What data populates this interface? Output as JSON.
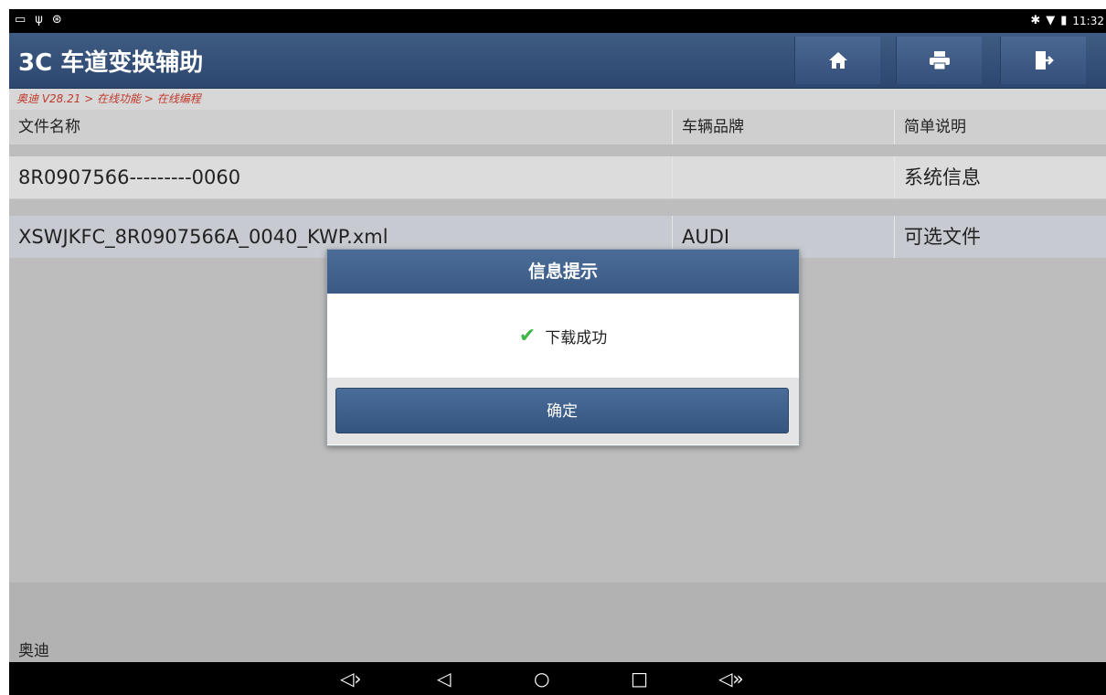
{
  "app": {
    "title": "3C 车道变换辅助",
    "breadcrumb": "奥迪 V28.21 > 在线功能 > 在线编程"
  },
  "status_bar": {
    "left_icons": [
      "image-icon",
      "usb-icon",
      "settings-icon"
    ],
    "right_icons": [
      "bluetooth-icon",
      "wifi-icon",
      "battery-icon"
    ],
    "time": "11:32"
  },
  "toolbar": {
    "home_icon": "home-icon",
    "print_icon": "print-icon",
    "exit_icon": "exit-icon"
  },
  "table": {
    "headers": [
      "文件名称",
      "车辆品牌",
      "简单说明"
    ],
    "rows": [
      [
        "8R0907566---------0060",
        "",
        "系统信息"
      ],
      [
        "XSWJKFC_8R0907566A_0040_KWP.xml",
        "AUDI",
        "可选文件"
      ]
    ]
  },
  "footer": {
    "label": "奥迪"
  },
  "dialog": {
    "title": "信息提示",
    "message": "下载成功",
    "ok_label": "确定"
  },
  "navbar": {
    "icons": [
      "volume-down-icon",
      "back-icon",
      "home-circle-icon",
      "recents-icon",
      "volume-up-icon"
    ]
  },
  "colors": {
    "title_bar": "#2f4a72",
    "breadcrumb_text": "#c0392b",
    "success_check": "#3fb54a"
  }
}
